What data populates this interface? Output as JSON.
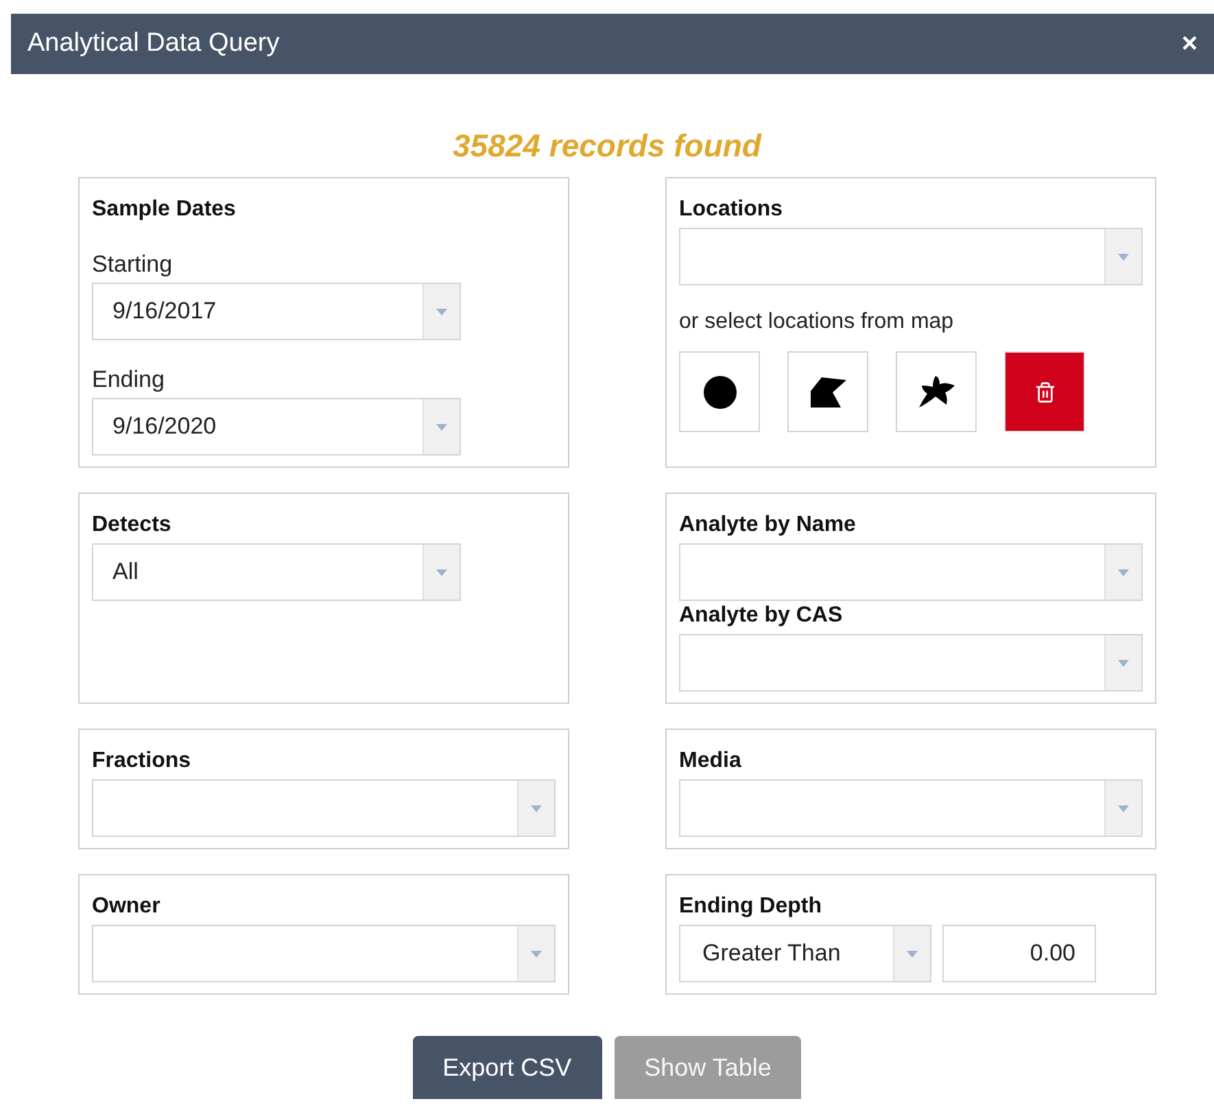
{
  "window": {
    "title": "Analytical Data Query",
    "close": "×"
  },
  "summary": "35824 records found",
  "panels": [
    {
      "fields": [
        {
          "kind": "heading",
          "text": "Sample Dates"
        },
        {
          "kind": "label",
          "text": "Starting"
        },
        {
          "kind": "select_short",
          "value": "9/16/2017"
        },
        {
          "kind": "label",
          "text": "Ending"
        },
        {
          "kind": "select_short",
          "value": "9/16/2020"
        }
      ]
    },
    {
      "fields": [
        {
          "kind": "heading",
          "text": "Locations"
        },
        {
          "kind": "select"
        },
        {
          "kind": "note",
          "text": "or select locations from map"
        },
        {
          "kind": "tools",
          "tools": [
            {
              "kind": "dot"
            },
            {
              "kind": "polygon"
            },
            {
              "kind": "freehand"
            },
            {
              "kind": "delete"
            }
          ]
        }
      ]
    },
    {
      "fields": [
        {
          "kind": "heading",
          "text": "Detects"
        },
        {
          "kind": "select_short",
          "value": "All"
        }
      ]
    },
    {
      "fields": [
        {
          "kind": "heading",
          "text": "Analyte by Name"
        },
        {
          "kind": "select"
        },
        {
          "kind": "heading",
          "text": "Analyte by CAS"
        },
        {
          "kind": "select"
        }
      ]
    },
    {
      "fields": [
        {
          "kind": "heading",
          "text": "Fractions"
        },
        {
          "kind": "select"
        }
      ]
    },
    {
      "fields": [
        {
          "kind": "heading",
          "text": "Media"
        },
        {
          "kind": "select"
        }
      ]
    },
    {
      "fields": [
        {
          "kind": "heading",
          "text": "Owner"
        },
        {
          "kind": "select"
        }
      ]
    },
    {
      "fields": [
        {
          "kind": "heading",
          "text": "Ending Depth"
        },
        {
          "kind": "depth",
          "operator": "Greater Than",
          "value": "0.00"
        }
      ]
    }
  ],
  "buttons": [
    {
      "label": "Export CSV",
      "disabled": false
    },
    {
      "label": "Show Table",
      "disabled": true
    }
  ]
}
